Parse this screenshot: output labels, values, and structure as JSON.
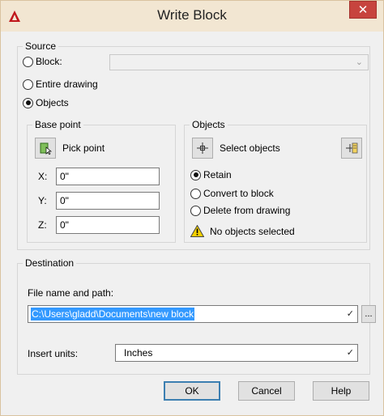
{
  "window": {
    "title": "Write Block",
    "close_symbol": "✕",
    "accent": "#c7443e",
    "app_icon_color": "#c0161b"
  },
  "source": {
    "group_label": "Source",
    "options": [
      {
        "label": "Block:",
        "checked": false
      },
      {
        "label": "Entire drawing",
        "checked": false
      },
      {
        "label": "Objects",
        "checked": true
      }
    ],
    "block_combo_value": ""
  },
  "base_point": {
    "group_label": "Base point",
    "pick_point_label": "Pick point",
    "x_label": "X:",
    "x_value": "0\"",
    "y_label": "Y:",
    "y_value": "0\"",
    "z_label": "Z:",
    "z_value": "0\""
  },
  "objects": {
    "group_label": "Objects",
    "select_objects_label": "Select objects",
    "options": [
      {
        "label": "Retain",
        "checked": true
      },
      {
        "label": "Convert to block",
        "checked": false
      },
      {
        "label": "Delete from drawing",
        "checked": false
      }
    ],
    "warning_text": "No objects selected"
  },
  "destination": {
    "group_label": "Destination",
    "file_label": "File name and path:",
    "file_value": "C:\\Users\\gladd\\Documents\\new block",
    "browse_label": "...",
    "units_label": "Insert units:",
    "units_value": "Inches"
  },
  "buttons": {
    "ok": "OK",
    "cancel": "Cancel",
    "help": "Help"
  }
}
